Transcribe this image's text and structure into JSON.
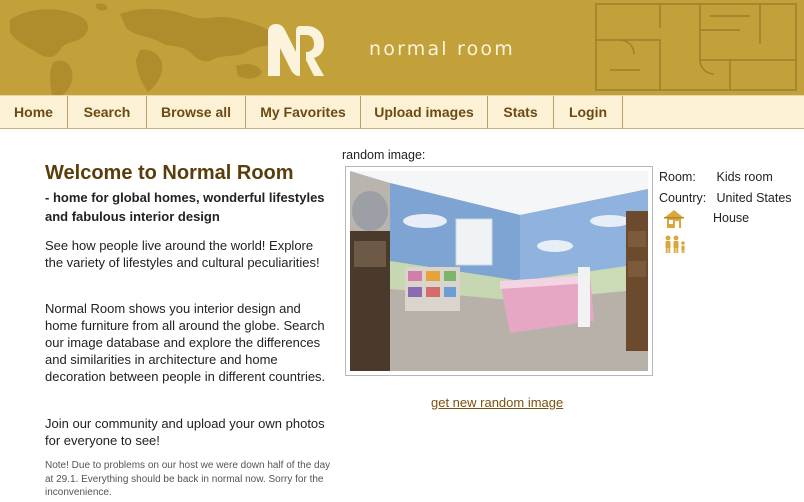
{
  "header": {
    "brand": "normal room",
    "logo_icon": "nr-logo-icon",
    "map_decor": "world-map",
    "plan_decor": "floor-plan"
  },
  "nav": {
    "items": [
      {
        "label": "Home"
      },
      {
        "label": "Search"
      },
      {
        "label": "Browse all"
      },
      {
        "label": "My Favorites"
      },
      {
        "label": "Upload images"
      },
      {
        "label": "Stats"
      },
      {
        "label": "Login"
      }
    ]
  },
  "main": {
    "title": "Welcome to Normal Room",
    "tagline": "- home for global homes, wonderful lifestyles and fabulous interior design",
    "paragraph1": "See how people live around the world! Explore the variety of lifestyles and cultural peculiarities!",
    "paragraph2": "Normal Room shows you interior design and home furniture from all around the globe. Search our image database and explore the differences and similarities in architecture and home decoration between people in different countries.",
    "paragraph3": "Join our community and upload your own photos for everyone to see!",
    "note": "Note! Due to problems on our host we were down half of the day at 29.1. Everything should be back in normal now. Sorry for the inconvenience."
  },
  "random": {
    "label": "random image:",
    "link": "get new random image"
  },
  "info": {
    "room_key": "Room:",
    "room_value": "Kids room",
    "country_key": "Country:",
    "country_value": "United States",
    "type_value": "House",
    "type_icon": "house-icon",
    "people_icon": "people-icon"
  },
  "colors": {
    "header_bg": "#c2a03a",
    "nav_bg": "#fdf1d6",
    "nav_text": "#6b4b12",
    "title": "#5a3d0c",
    "link": "#7a5210"
  }
}
